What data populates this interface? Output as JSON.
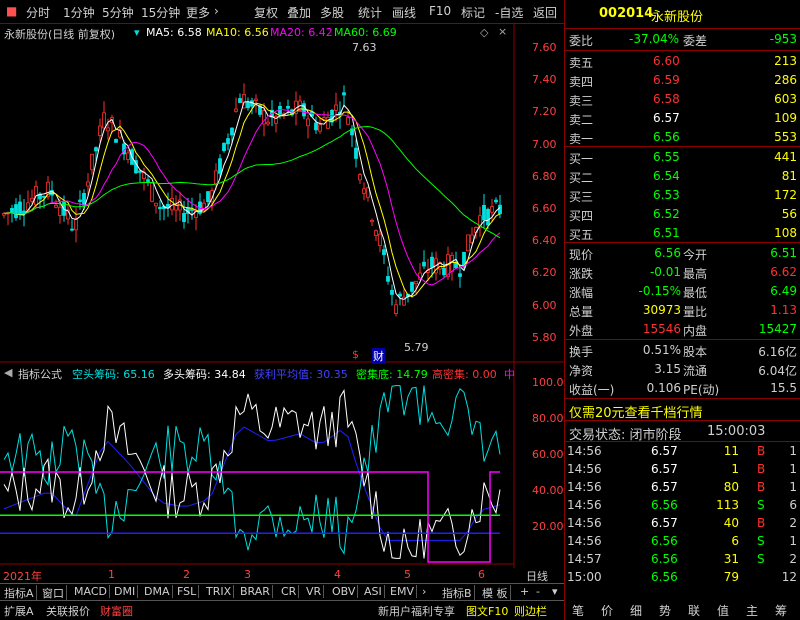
{
  "menu": {
    "items": [
      "分时",
      "1分钟",
      "5分钟",
      "15分钟",
      "更多"
    ],
    "more_arrow": "›",
    "tools": [
      "复权",
      "叠加",
      "多股",
      "统计",
      "画线",
      "F10",
      "标记",
      "-自选",
      "返回"
    ]
  },
  "stock": {
    "code": "002014",
    "name": "永新股份"
  },
  "chart": {
    "title": "永新股份(日线 前复权)",
    "ma5": "MA5: 6.58",
    "ma10": "MA10: 6.56",
    "ma20": "MA20: 6.42",
    "ma60": "MA60: 6.69",
    "high_label": "7.63",
    "low_label": "5.79",
    "marker_dollar": "$",
    "marker_cai": "财",
    "price_ticks": [
      "7.60",
      "7.40",
      "7.20",
      "7.00",
      "6.80",
      "6.60",
      "6.40",
      "6.20",
      "6.00",
      "5.80"
    ],
    "colors": {
      "up": "#ff3030",
      "down": "#00e0e0",
      "ma5": "#ffffff",
      "ma10": "#ffff00",
      "ma20": "#ff00ff",
      "ma60": "#00ff00"
    }
  },
  "indicator": {
    "label": "指标公式",
    "short_chip": "空头筹码: 65.16",
    "long_chip": "多头筹码: 34.84",
    "avg_cost": "获利平均值: 30.35",
    "dense_low": "密集底: 14.79",
    "dense_high": "高密集: 0.00",
    "more": "中",
    "ticks": [
      "100.0",
      "80.00",
      "60.00",
      "40.00",
      "20.00"
    ]
  },
  "xaxis": {
    "year": "2021年",
    "months": [
      "1",
      "2",
      "3",
      "4",
      "5",
      "6"
    ],
    "period": "日线"
  },
  "tabs": [
    "指标A",
    "窗口",
    "MACD",
    "DMI",
    "DMA",
    "FSL",
    "TRIX",
    "BRAR",
    "CR",
    "VR",
    "OBV",
    "ASI",
    "EMV"
  ],
  "tabs_right": [
    "指标B",
    "模 板"
  ],
  "bottom_left": [
    "扩展A",
    "关联报价",
    "财富圈"
  ],
  "bottom_promo": [
    "新用户福利专享",
    "图文F10",
    "则边栏"
  ],
  "nav": [
    "笔",
    "价",
    "细",
    "势",
    "联",
    "值",
    "主",
    "筹"
  ],
  "wb": {
    "ratio_label": "委比",
    "ratio": "-37.04%",
    "diff_label": "委差",
    "diff": "-953",
    "asks": [
      {
        "label": "卖五",
        "price": "6.60",
        "vol": "213"
      },
      {
        "label": "卖四",
        "price": "6.59",
        "vol": "286"
      },
      {
        "label": "卖三",
        "price": "6.58",
        "vol": "603"
      },
      {
        "label": "卖二",
        "price": "6.57",
        "vol": "109"
      },
      {
        "label": "卖一",
        "price": "6.56",
        "vol": "553"
      }
    ],
    "bids": [
      {
        "label": "买一",
        "price": "6.55",
        "vol": "441"
      },
      {
        "label": "买二",
        "price": "6.54",
        "vol": "81"
      },
      {
        "label": "买三",
        "price": "6.53",
        "vol": "172"
      },
      {
        "label": "买四",
        "price": "6.52",
        "vol": "56"
      },
      {
        "label": "买五",
        "price": "6.51",
        "vol": "108"
      }
    ]
  },
  "quote": [
    {
      "l1": "现价",
      "v1": "6.56",
      "l2": "今开",
      "v2": "6.51"
    },
    {
      "l1": "涨跌",
      "v1": "-0.01",
      "l2": "最高",
      "v2": "6.62"
    },
    {
      "l1": "涨幅",
      "v1": "-0.15%",
      "l2": "最低",
      "v2": "6.49"
    },
    {
      "l1": "总量",
      "v1": "30973",
      "l2": "量比",
      "v2": "1.13"
    },
    {
      "l1": "外盘",
      "v1": "15546",
      "l2": "内盘",
      "v2": "15427"
    }
  ],
  "fund": [
    {
      "l1": "换手",
      "v1": "0.51%",
      "l2": "股本",
      "v2": "6.16亿"
    },
    {
      "l1": "净资",
      "v1": "3.15",
      "l2": "流通",
      "v2": "6.04亿"
    },
    {
      "l1": "收益(一)",
      "v1": "0.106",
      "l2": "PE(动)",
      "v2": "15.5"
    }
  ],
  "promo": "仅需20元查看千档行情",
  "status": {
    "label": "交易状态: 闭市阶段",
    "time": "15:00:03"
  },
  "ticks": [
    {
      "t": "14:56",
      "p": "6.57",
      "v": "11",
      "d": "B",
      "n": "1"
    },
    {
      "t": "14:56",
      "p": "6.57",
      "v": "1",
      "d": "B",
      "n": "1"
    },
    {
      "t": "14:56",
      "p": "6.57",
      "v": "80",
      "d": "B",
      "n": "1"
    },
    {
      "t": "14:56",
      "p": "6.56",
      "v": "113",
      "d": "S",
      "n": "6"
    },
    {
      "t": "14:56",
      "p": "6.57",
      "v": "40",
      "d": "B",
      "n": "2"
    },
    {
      "t": "14:56",
      "p": "6.56",
      "v": "6",
      "d": "S",
      "n": "1"
    },
    {
      "t": "14:57",
      "p": "6.56",
      "v": "31",
      "d": "S",
      "n": "2"
    },
    {
      "t": "15:00",
      "p": "6.56",
      "v": "79",
      "d": "",
      "n": "12"
    }
  ]
}
